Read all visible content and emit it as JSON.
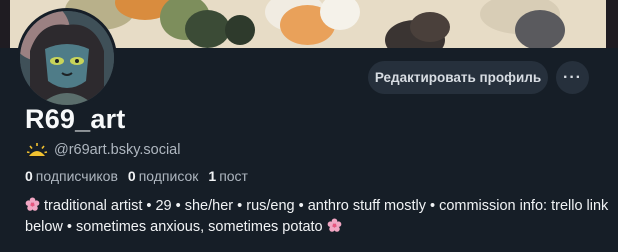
{
  "profile": {
    "display_name": "R69_art",
    "handle": "@r69art.bsky.social",
    "handle_icon": "sun-icon"
  },
  "actions": {
    "edit_label": "Редактировать профиль",
    "more_label": "···"
  },
  "stats": {
    "followers_count": "0",
    "followers_label": "подписчиков",
    "following_count": "0",
    "following_label": "подписок",
    "posts_count": "1",
    "posts_label": "пост"
  },
  "bio": {
    "text": "traditional artist • 29 • she/her • rus/eng • anthro stuff mostly • commission info: trello link below • sometimes anxious, sometimes potato",
    "leading_icon": "cherry-blossom-icon",
    "trailing_icon": "cherry-blossom-icon"
  },
  "colors": {
    "background": "#161e27",
    "button_bg": "#26303c",
    "muted_text": "#aeb6bf",
    "flower": "#f1a6c3"
  }
}
